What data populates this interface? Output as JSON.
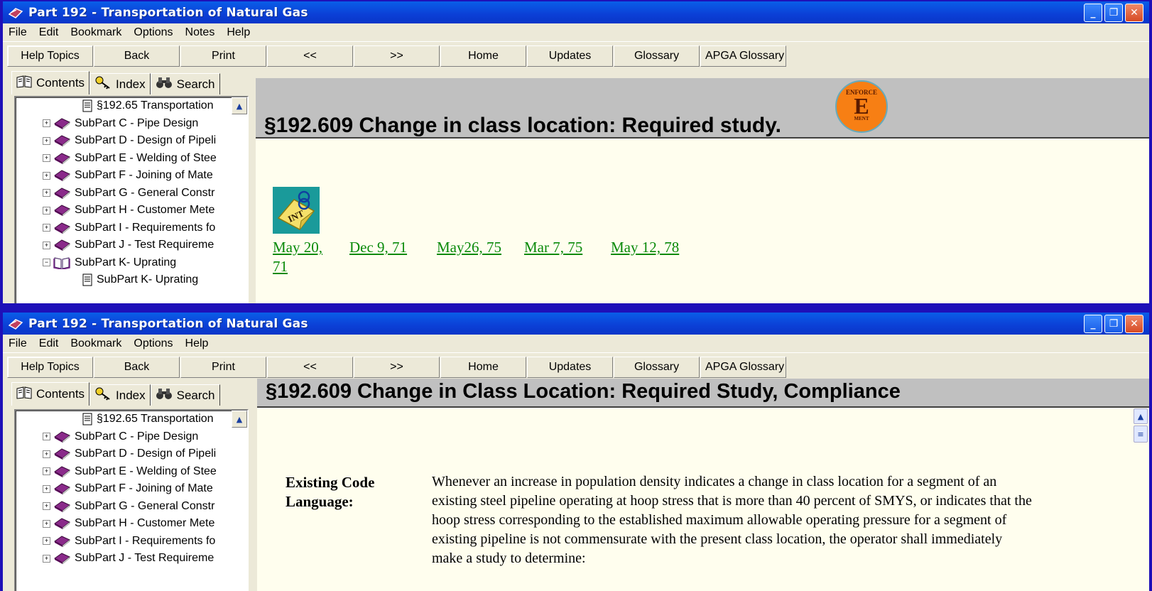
{
  "window1": {
    "title": "Part 192 - Transportation of Natural Gas",
    "menu": [
      "File",
      "Edit",
      "Bookmark",
      "Options",
      "Notes",
      "Help"
    ],
    "toolbar": [
      "Help Topics",
      "Back",
      "Print",
      "<<",
      ">>",
      "Home",
      "Updates",
      "Glossary",
      "APGA Glossary"
    ],
    "tabs": [
      "Contents",
      "Index",
      "Search"
    ],
    "tree": [
      {
        "label": "§192.65  Transportation",
        "type": "page"
      },
      {
        "label": "SubPart  C - Pipe Design",
        "type": "book",
        "expander": "+"
      },
      {
        "label": "SubPart  D - Design of Pipeli",
        "type": "book",
        "expander": "+"
      },
      {
        "label": "SubPart  E - Welding of Stee",
        "type": "book",
        "expander": "+"
      },
      {
        "label": "SubPart  F - Joining of Mate",
        "type": "book",
        "expander": "+"
      },
      {
        "label": "SubPart  G - General Constr",
        "type": "book",
        "expander": "+"
      },
      {
        "label": "SubPart  H - Customer Mete",
        "type": "book",
        "expander": "+"
      },
      {
        "label": "SubPart  I - Requirements fo",
        "type": "book",
        "expander": "+"
      },
      {
        "label": "SubPart  J - Test Requireme",
        "type": "book",
        "expander": "+"
      },
      {
        "label": "SubPart  K- Uprating",
        "type": "open-book",
        "expander": "−"
      },
      {
        "label": "SubPart  K- Uprating",
        "type": "page"
      }
    ],
    "heading": "§192.609  Change in class location:  Required study.",
    "badge": {
      "top": "ENFORCE",
      "letter": "E",
      "bottom": "MENT"
    },
    "int_icon_label": "INT",
    "links": [
      "May 20,",
      "71",
      "Dec 9, 71",
      "May26, 75",
      "Mar 7, 75",
      "May 12, 78"
    ]
  },
  "window2": {
    "title": "Part 192 - Transportation of Natural Gas",
    "menu": [
      "File",
      "Edit",
      "Bookmark",
      "Options",
      "Help"
    ],
    "toolbar": [
      "Help Topics",
      "Back",
      "Print",
      "<<",
      ">>",
      "Home",
      "Updates",
      "Glossary",
      "APGA Glossary"
    ],
    "tabs": [
      "Contents",
      "Index",
      "Search"
    ],
    "tree": [
      {
        "label": "§192.65  Transportation",
        "type": "page"
      },
      {
        "label": "SubPart  C - Pipe Design",
        "type": "book",
        "expander": "+"
      },
      {
        "label": "SubPart  D - Design of Pipeli",
        "type": "book",
        "expander": "+"
      },
      {
        "label": "SubPart  E - Welding of Stee",
        "type": "book",
        "expander": "+"
      },
      {
        "label": "SubPart  F - Joining of Mate",
        "type": "book",
        "expander": "+"
      },
      {
        "label": "SubPart  G - General Constr",
        "type": "book",
        "expander": "+"
      },
      {
        "label": "SubPart  H - Customer Mete",
        "type": "book",
        "expander": "+"
      },
      {
        "label": "SubPart  I - Requirements fo",
        "type": "book",
        "expander": "+"
      },
      {
        "label": "SubPart  J - Test Requireme",
        "type": "book",
        "expander": "+"
      }
    ],
    "heading": "§192.609  Change in Class Location: Required Study, Compliance",
    "label_line1": "Existing Code",
    "label_line2": "Language:",
    "text": "Whenever an increase in population density indicates a change in class location for a segment of an existing steel pipeline operating at hoop stress that is more than 40 percent of SMYS, or indicates that the hoop stress corresponding to the established maximum allowable operating pressure for a segment of existing pipeline is not commensurate with the present class location, the operator shall immediately make a study to determine:"
  },
  "colors": {
    "background": "#1e10b8",
    "titlebar": "#0b3fd6",
    "link": "#0a8a0a",
    "content_bg": "#fffeee",
    "badge": "#f77f14"
  }
}
